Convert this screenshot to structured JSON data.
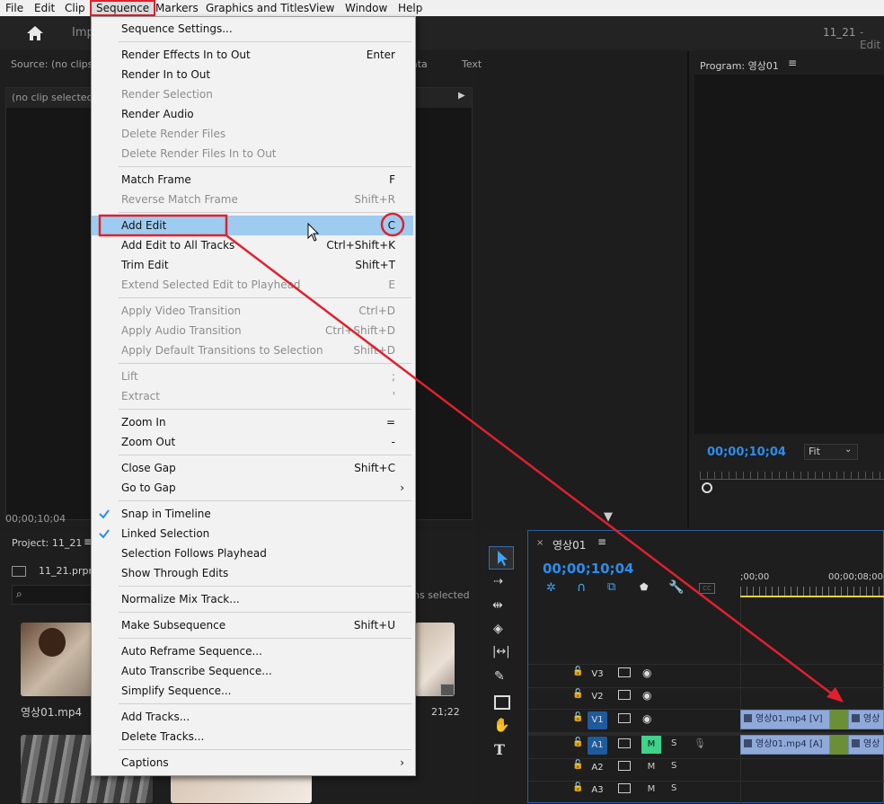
{
  "menubar": {
    "items": [
      "File",
      "Edit",
      "Clip",
      "Sequence",
      "Markers",
      "Graphics and Titles",
      "View",
      "Window",
      "Help"
    ],
    "active": "Sequence"
  },
  "header": {
    "import_label": "Imp",
    "project_name": "11_21",
    "workspace_fragment": "- Edit"
  },
  "source_panel": {
    "title": "Source: (no clips)",
    "dropdown": "(no clip selected)",
    "timecode": "00;00;10;04",
    "tab_fragments": [
      "ata",
      "Text"
    ]
  },
  "program_panel": {
    "title": "Program: 영상01",
    "timecode": "00;00;10;04",
    "fit": "Fit"
  },
  "project_panel": {
    "title": "Project: 11_21",
    "file": "11_21.prproj",
    "items_selected": "ns selected",
    "clips": [
      {
        "name": "영상01.mp4",
        "duration": ""
      },
      {
        "name": "",
        "duration": "21;22"
      }
    ]
  },
  "timeline": {
    "sequence_name": "영상01",
    "timecode": "00;00;10;04",
    "ruler": [
      ";00;00",
      "00;00;08;00"
    ],
    "tracks": [
      {
        "label": "V3",
        "type": "video"
      },
      {
        "label": "V2",
        "type": "video"
      },
      {
        "label": "V1",
        "type": "video",
        "active": true
      },
      {
        "label": "A1",
        "type": "audio",
        "active": true,
        "mute_on": true
      },
      {
        "label": "A2",
        "type": "audio"
      },
      {
        "label": "A3",
        "type": "audio"
      }
    ],
    "clip_labels": {
      "v1_a": "영상01.mp4 [V]",
      "v1_b": "영상",
      "a1_a": "영상01.mp4 [A]",
      "a1_b": "영상"
    },
    "m_label": "M",
    "s_label": "S"
  },
  "menu": {
    "items": [
      {
        "label": "Sequence Settings...",
        "shortcut": "",
        "disabled": false
      },
      {
        "sep": true
      },
      {
        "label": "Render Effects In to Out",
        "shortcut": "Enter",
        "disabled": false
      },
      {
        "label": "Render In to Out",
        "shortcut": "",
        "disabled": false
      },
      {
        "label": "Render Selection",
        "shortcut": "",
        "disabled": true
      },
      {
        "label": "Render Audio",
        "shortcut": "",
        "disabled": false
      },
      {
        "label": "Delete Render Files",
        "shortcut": "",
        "disabled": true
      },
      {
        "label": "Delete Render Files In to Out",
        "shortcut": "",
        "disabled": true
      },
      {
        "sep": true
      },
      {
        "label": "Match Frame",
        "shortcut": "F",
        "disabled": false
      },
      {
        "label": "Reverse Match Frame",
        "shortcut": "Shift+R",
        "disabled": true
      },
      {
        "sep": true
      },
      {
        "label": "Add Edit",
        "shortcut": "C",
        "disabled": false,
        "highlighted": true
      },
      {
        "label": "Add Edit to All Tracks",
        "shortcut": "Ctrl+Shift+K",
        "disabled": false
      },
      {
        "label": "Trim Edit",
        "shortcut": "Shift+T",
        "disabled": false
      },
      {
        "label": "Extend Selected Edit to Playhead",
        "shortcut": "E",
        "disabled": true
      },
      {
        "sep": true
      },
      {
        "label": "Apply Video Transition",
        "shortcut": "Ctrl+D",
        "disabled": true
      },
      {
        "label": "Apply Audio Transition",
        "shortcut": "Ctrl+Shift+D",
        "disabled": true
      },
      {
        "label": "Apply Default Transitions to Selection",
        "shortcut": "Shift+D",
        "disabled": true
      },
      {
        "sep": true
      },
      {
        "label": "Lift",
        "shortcut": ";",
        "disabled": true
      },
      {
        "label": "Extract",
        "shortcut": "'",
        "disabled": true
      },
      {
        "sep": true
      },
      {
        "label": "Zoom In",
        "shortcut": "=",
        "disabled": false
      },
      {
        "label": "Zoom Out",
        "shortcut": "-",
        "disabled": false
      },
      {
        "sep": true
      },
      {
        "label": "Close Gap",
        "shortcut": "Shift+C",
        "disabled": false
      },
      {
        "label": "Go to Gap",
        "shortcut": "",
        "disabled": false,
        "submenu": true
      },
      {
        "sep": true
      },
      {
        "label": "Snap in Timeline",
        "shortcut": "",
        "disabled": false,
        "checked": true
      },
      {
        "label": "Linked Selection",
        "shortcut": "",
        "disabled": false,
        "checked": true
      },
      {
        "label": "Selection Follows Playhead",
        "shortcut": "",
        "disabled": false
      },
      {
        "label": "Show Through Edits",
        "shortcut": "",
        "disabled": false
      },
      {
        "sep": true
      },
      {
        "label": "Normalize Mix Track...",
        "shortcut": "",
        "disabled": false
      },
      {
        "sep": true
      },
      {
        "label": "Make Subsequence",
        "shortcut": "Shift+U",
        "disabled": false
      },
      {
        "sep": true
      },
      {
        "label": "Auto Reframe Sequence...",
        "shortcut": "",
        "disabled": false
      },
      {
        "label": "Auto Transcribe Sequence...",
        "shortcut": "",
        "disabled": false
      },
      {
        "label": "Simplify Sequence...",
        "shortcut": "",
        "disabled": false
      },
      {
        "sep": true
      },
      {
        "label": "Add Tracks...",
        "shortcut": "",
        "disabled": false
      },
      {
        "label": "Delete Tracks...",
        "shortcut": "",
        "disabled": false
      },
      {
        "sep": true
      },
      {
        "label": "Captions",
        "shortcut": "",
        "disabled": false,
        "submenu": true
      }
    ]
  },
  "colors": {
    "accent_blue": "#2d8ceb",
    "annotation_red": "#e0202e",
    "highlight": "#9ecbf0",
    "clip_blue": "#8fa9d8",
    "mute_green": "#3fd28a"
  }
}
